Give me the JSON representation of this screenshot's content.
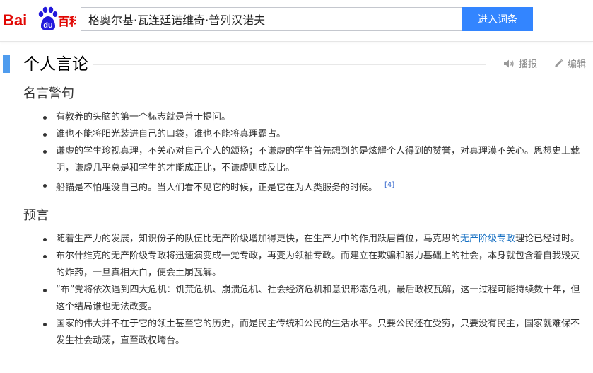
{
  "colors": {
    "accent": "#3385ff",
    "section_bar": "#4f9cee",
    "link": "#136ec2",
    "logo_red": "#e10602",
    "logo_blue": "#2319dc"
  },
  "header": {
    "logo_text_left": "Bai",
    "logo_paw_text": "du",
    "logo_text_right": "百科",
    "search_value": "格奥尔基·瓦连廷诺维奇·普列汉诺夫",
    "search_button_label": "进入词条"
  },
  "section": {
    "title": "个人言论",
    "tools": {
      "broadcast_label": "播报",
      "broadcast_icon": "speaker-icon",
      "edit_label": "编辑",
      "edit_icon": "pencil-icon"
    }
  },
  "subsections": [
    {
      "title": "名言警句",
      "items": [
        {
          "text": "有教养的头脑的第一个标志就是善于提问。"
        },
        {
          "text": "谁也不能将阳光装进自己的口袋，谁也不能将真理霸占。"
        },
        {
          "text": "谦虚的学生珍视真理，不关心对自己个人的颂扬；不谦虚的学生首先想到的是炫耀个人得到的赞誉，对真理漠不关心。思想史上载明，谦虚几乎总是和学生的才能成正比，不谦虚则成反比。"
        },
        {
          "text": "船锚是不怕埋没自己的。当人们看不见它的时候，正是它在为人类服务的时候。",
          "ref": "[4]"
        }
      ]
    },
    {
      "title": "预言",
      "items": [
        {
          "text_before": "随着生产力的发展，知识份子的队伍比无产阶级增加得更快，在生产力中的作用跃居首位，马克思的",
          "link": "无产阶级专政",
          "text_after": "理论已经过时。"
        },
        {
          "text": "布尔什维克的无产阶级专政将迅速演变成一党专政，再变为领袖专政。而建立在欺骗和暴力基础上的社会，本身就包含着自我毁灭的炸药，一旦真相大白，便会土崩瓦解。"
        },
        {
          "text": "“布”党将依次遇到四大危机：饥荒危机、崩溃危机、社会经济危机和意识形态危机，最后政权瓦解，这一过程可能持续数十年，但这个结局谁也无法改变。"
        },
        {
          "text": "国家的伟大并不在于它的领土甚至它的历史，而是民主传统和公民的生活水平。只要公民还在受穷，只要没有民主，国家就难保不发生社会动荡，直至政权垮台。"
        }
      ]
    }
  ]
}
